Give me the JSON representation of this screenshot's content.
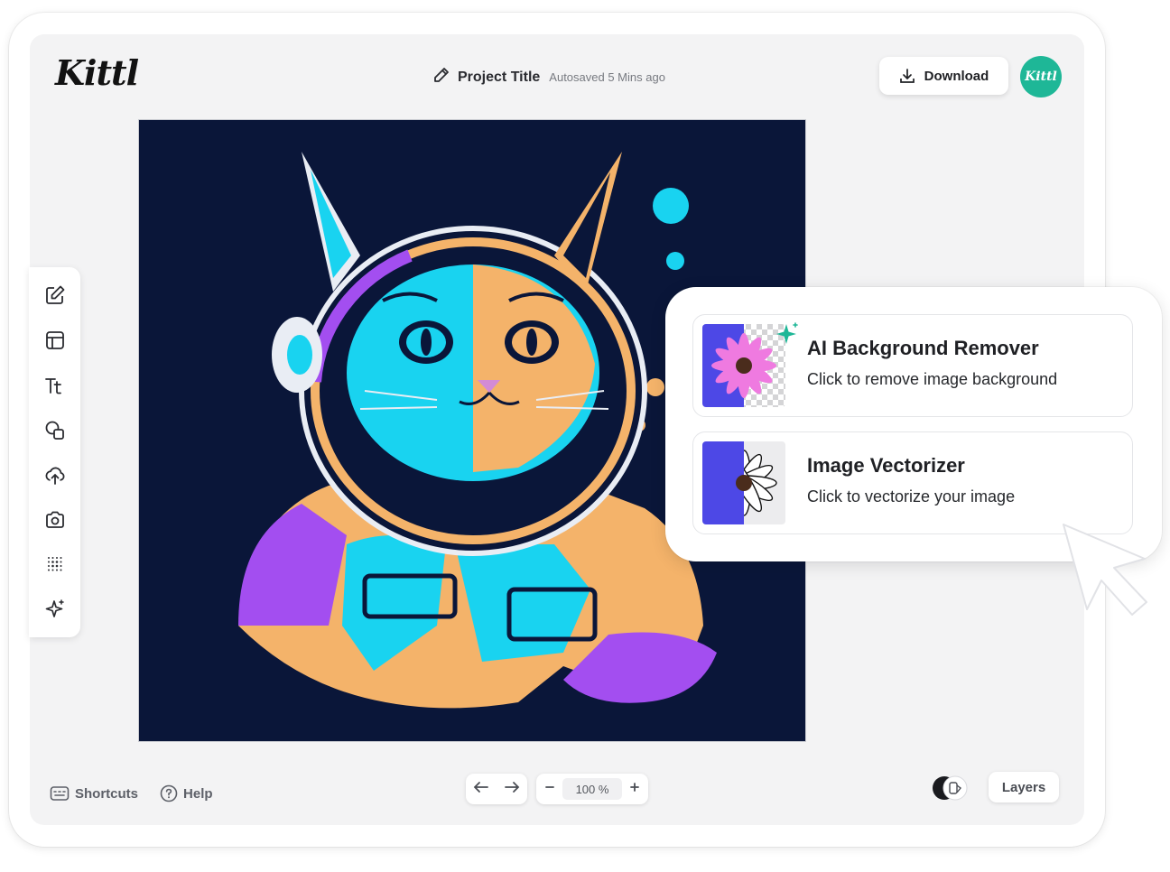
{
  "app": {
    "logo": "Kittl",
    "avatar_text": "Kittl",
    "accent": "#1eb797"
  },
  "header": {
    "project_title": "Project Title",
    "autosave": "Autosaved 5 Mins ago",
    "download_label": "Download"
  },
  "toolbar": {
    "tools": [
      "edit-icon",
      "templates-icon",
      "text-icon",
      "shapes-icon",
      "upload-icon",
      "camera-icon",
      "texture-icon",
      "ai-sparkle-icon"
    ]
  },
  "footer": {
    "shortcuts_label": "Shortcuts",
    "help_label": "Help",
    "zoom": "100 %",
    "layers_label": "Layers"
  },
  "popup": {
    "cards": [
      {
        "title": "AI Background Remover",
        "desc": "Click to remove image background"
      },
      {
        "title": "Image Vectorizer",
        "desc": "Click to vectorize your image"
      }
    ]
  },
  "colors": {
    "canvas_bg": "#0a1639",
    "cyan": "#19d3f0",
    "orange": "#f4b36a",
    "purple": "#a34ef0"
  }
}
